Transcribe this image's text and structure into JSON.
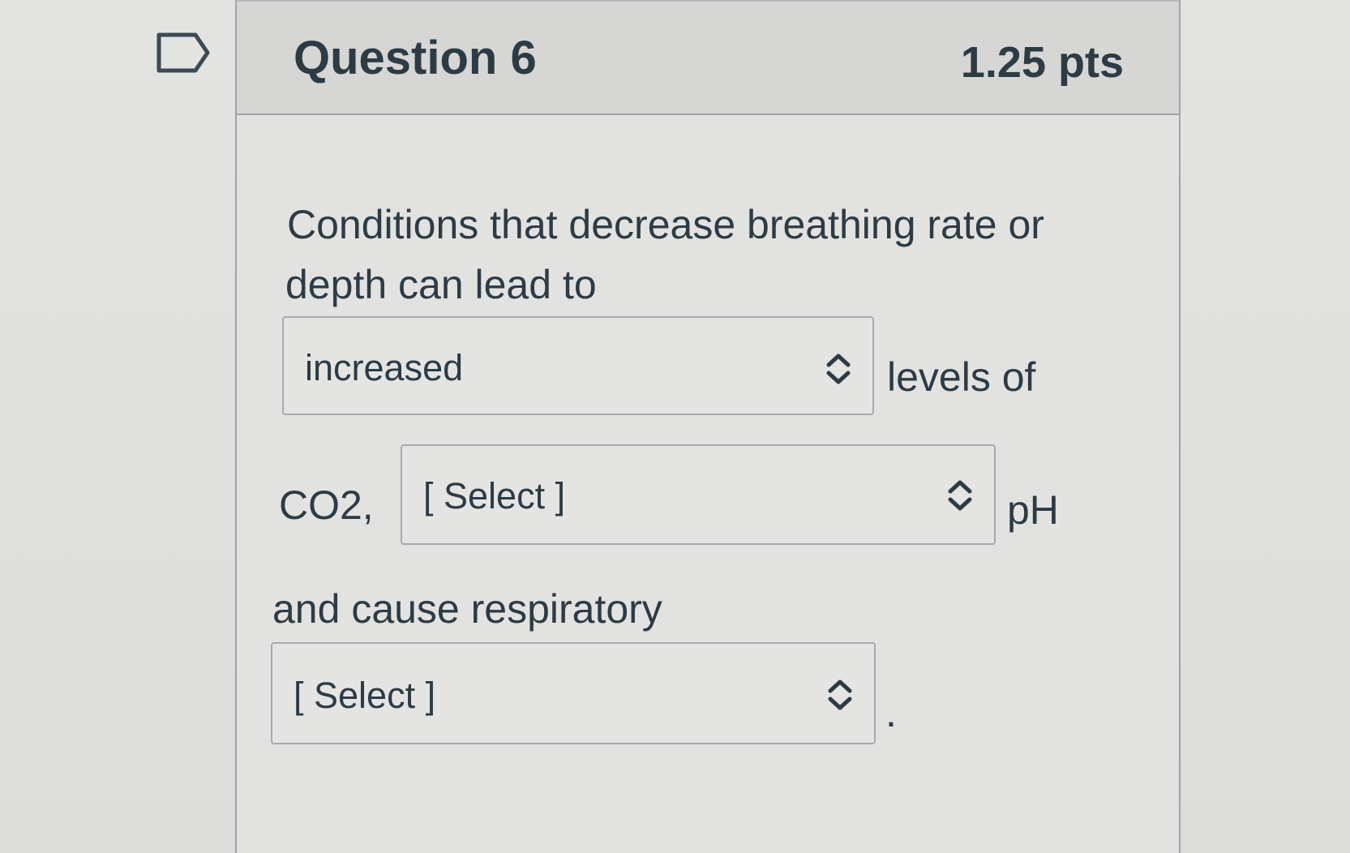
{
  "question": {
    "title": "Question 6",
    "points": "1.25 pts"
  },
  "body": {
    "line1": "Conditions that decrease breathing rate or",
    "line2": "depth can lead to",
    "after_select1": "levels of",
    "before_select2": "CO2,",
    "after_select2": "pH",
    "line4": "and cause respiratory",
    "end_punct": "."
  },
  "selects": {
    "select1_value": "increased",
    "select2_value": "[ Select ]",
    "select3_value": "[ Select ]"
  },
  "icons": {
    "flag": "flag-outline-icon",
    "select_arrow": "up-down-chevron-icon"
  },
  "colors": {
    "text": "#2d3b45",
    "header_bg": "#d6d7d5",
    "border": "#a5aaac"
  }
}
